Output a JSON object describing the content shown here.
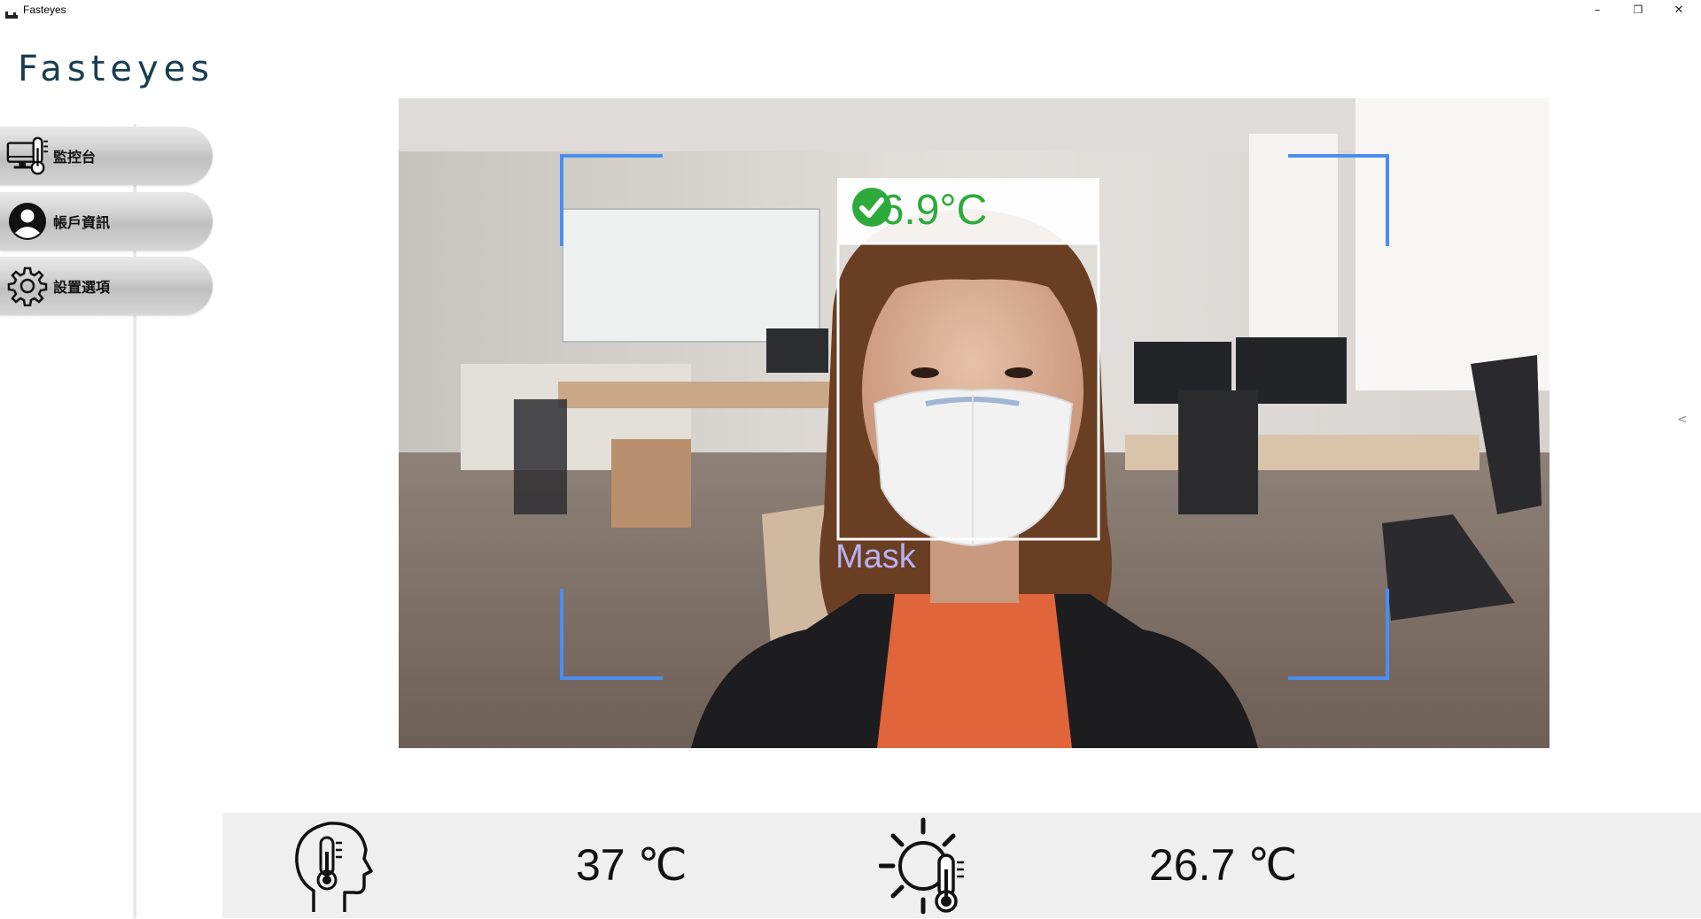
{
  "window": {
    "title": "Fasteyes",
    "controls": {
      "minimize": "–",
      "restore": "❐",
      "close": "✕"
    }
  },
  "logo": {
    "text": "Fasteyes"
  },
  "sidebar": {
    "items": [
      {
        "label": "監控台",
        "icon": "monitor-thermometer-icon"
      },
      {
        "label": "帳戶資訊",
        "icon": "user-account-icon"
      },
      {
        "label": "設置選項",
        "icon": "gear-icon"
      }
    ]
  },
  "camera": {
    "face_temperature": "36.9°C",
    "status_icon": "check-circle-icon",
    "status_color": "#2eaa3c",
    "mask_label": "Mask",
    "mask_label_color": "#b9b2f2",
    "frame_color": "#4b8ef0"
  },
  "collapse_arrow": "<",
  "bottom": {
    "body_temperature": "37 ℃",
    "body_icon": "head-thermometer-icon",
    "ambient_temperature": "26.7 ℃",
    "ambient_icon": "sun-thermometer-icon"
  }
}
